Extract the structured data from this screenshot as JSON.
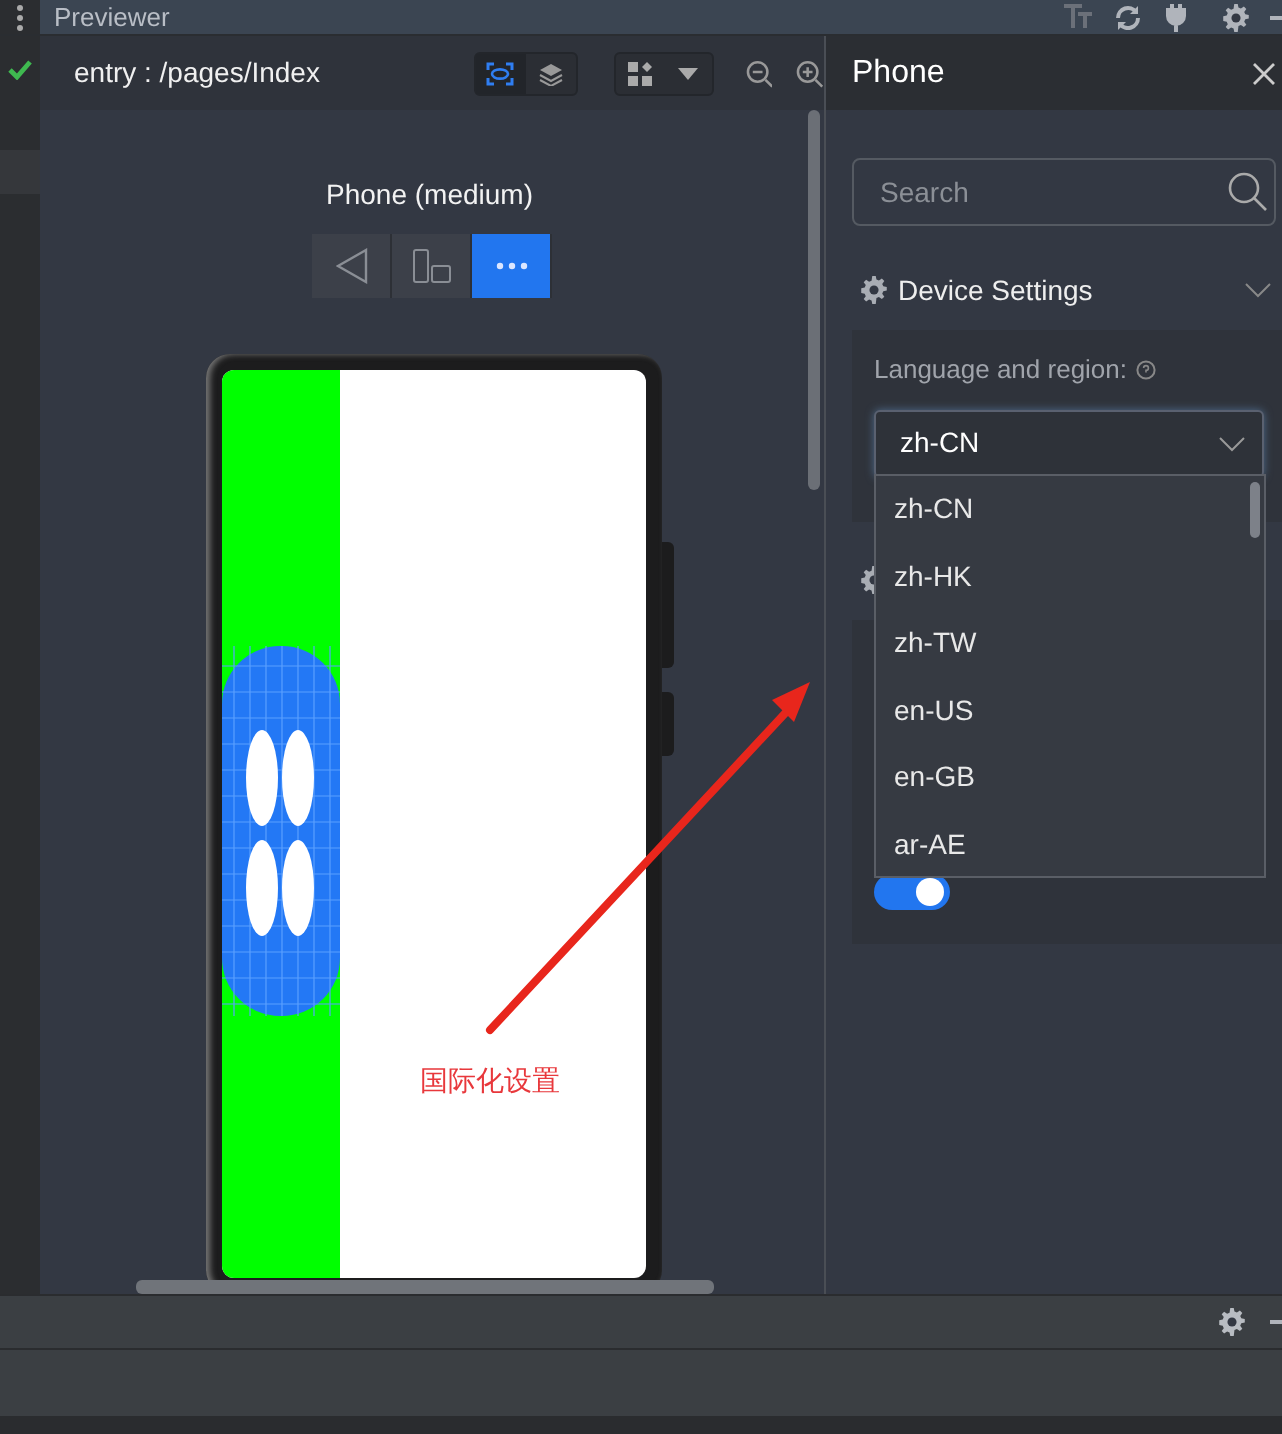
{
  "title_bar": {
    "title": "Previewer"
  },
  "preview": {
    "route": "entry : /pages/Index",
    "inspect_selected": true,
    "device_name": "Phone (medium)",
    "device_buttons": [
      {
        "kind": "back",
        "selected": false
      },
      {
        "kind": "rotate",
        "selected": false
      },
      {
        "kind": "more",
        "selected": true
      }
    ],
    "annotation": "国际化设置"
  },
  "panel": {
    "title": "Phone",
    "search": {
      "placeholder": "Search"
    },
    "section": {
      "title": "Device Settings",
      "expanded": true
    },
    "language": {
      "label": "Language and region:",
      "value": "zh-CN",
      "open": true,
      "options": [
        "zh-CN",
        "zh-HK",
        "zh-TW",
        "en-US",
        "en-GB",
        "ar-AE"
      ]
    },
    "toggle": {
      "on": true
    }
  }
}
